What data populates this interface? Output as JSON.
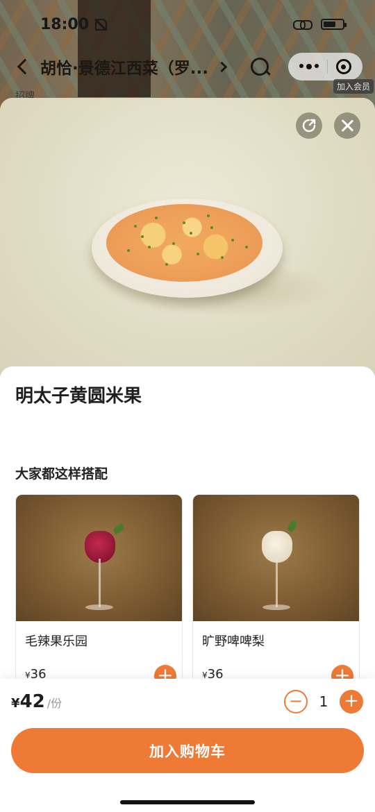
{
  "status_bar": {
    "time": "18:00"
  },
  "nav": {
    "title": "胡恰·景德江西菜（罗...",
    "member_tag": "加入会员"
  },
  "background": {
    "sub_label": "招牌"
  },
  "dish": {
    "name": "明太子黄圆米果",
    "price_symbol": "¥",
    "price": "42",
    "unit": "/份",
    "quantity": "1"
  },
  "pairing": {
    "title": "大家都这样搭配",
    "items": [
      {
        "name": "毛辣果乐园",
        "price_symbol": "¥",
        "price": "36"
      },
      {
        "name": "旷野啤啤梨",
        "price_symbol": "¥",
        "price": "36"
      }
    ]
  },
  "actions": {
    "add_to_cart": "加入购物车"
  },
  "colors": {
    "accent": "#ef7a35"
  },
  "icons": [
    "bell-muted-icon",
    "link-icon",
    "battery-icon",
    "back-icon",
    "search-icon",
    "more-icon",
    "target-icon",
    "share-icon",
    "close-icon",
    "plus-icon",
    "minus-icon"
  ]
}
